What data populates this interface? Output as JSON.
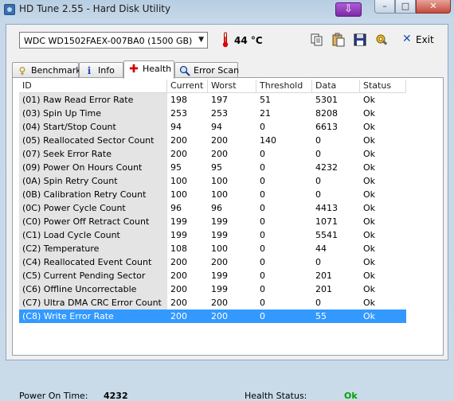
{
  "window": {
    "title": "HD Tune 2.55 - Hard Disk Utility",
    "download_glyph": "⇩",
    "min_glyph": "–",
    "max_glyph": "□",
    "close_glyph": "✕"
  },
  "toolbar": {
    "drive": "WDC WD1502FAEX-007BA0 (1500 GB)",
    "temperature": "44 °C",
    "exit_label": "Exit",
    "icons": [
      "copy-icon",
      "paste-icon",
      "save-icon",
      "options-icon"
    ]
  },
  "tabs": [
    {
      "label": "Benchmark",
      "icon": "benchmark-icon"
    },
    {
      "label": "Info",
      "icon": "info-icon"
    },
    {
      "label": "Health",
      "icon": "health-icon",
      "active": true
    },
    {
      "label": "Error Scan",
      "icon": "magnifier-icon"
    }
  ],
  "table": {
    "columns": [
      "ID",
      "Current",
      "Worst",
      "Threshold",
      "Data",
      "Status"
    ],
    "rows": [
      [
        "(01) Raw Read Error Rate",
        "198",
        "197",
        "51",
        "5301",
        "Ok"
      ],
      [
        "(03) Spin Up Time",
        "253",
        "253",
        "21",
        "8208",
        "Ok"
      ],
      [
        "(04) Start/Stop Count",
        "94",
        "94",
        "0",
        "6613",
        "Ok"
      ],
      [
        "(05) Reallocated Sector Count",
        "200",
        "200",
        "140",
        "0",
        "Ok"
      ],
      [
        "(07) Seek Error Rate",
        "200",
        "200",
        "0",
        "0",
        "Ok"
      ],
      [
        "(09) Power On Hours Count",
        "95",
        "95",
        "0",
        "4232",
        "Ok"
      ],
      [
        "(0A) Spin Retry Count",
        "100",
        "100",
        "0",
        "0",
        "Ok"
      ],
      [
        "(0B) Calibration Retry Count",
        "100",
        "100",
        "0",
        "0",
        "Ok"
      ],
      [
        "(0C) Power Cycle Count",
        "96",
        "96",
        "0",
        "4413",
        "Ok"
      ],
      [
        "(C0) Power Off Retract Count",
        "199",
        "199",
        "0",
        "1071",
        "Ok"
      ],
      [
        "(C1) Load Cycle Count",
        "199",
        "199",
        "0",
        "5541",
        "Ok"
      ],
      [
        "(C2) Temperature",
        "108",
        "100",
        "0",
        "44",
        "Ok"
      ],
      [
        "(C4) Reallocated Event Count",
        "200",
        "200",
        "0",
        "0",
        "Ok"
      ],
      [
        "(C5) Current Pending Sector",
        "200",
        "199",
        "0",
        "201",
        "Ok"
      ],
      [
        "(C6) Offline Uncorrectable",
        "200",
        "199",
        "0",
        "201",
        "Ok"
      ],
      [
        "(C7) Ultra DMA CRC Error Count",
        "200",
        "200",
        "0",
        "0",
        "Ok"
      ],
      [
        "(C8) Write Error Rate",
        "200",
        "200",
        "0",
        "55",
        "Ok"
      ]
    ],
    "selected_row": 16
  },
  "footer": {
    "power_on_label": "Power On Time:",
    "power_on_value": "4232",
    "health_label": "Health Status:",
    "health_value": "Ok",
    "health_color": "#00a000"
  }
}
